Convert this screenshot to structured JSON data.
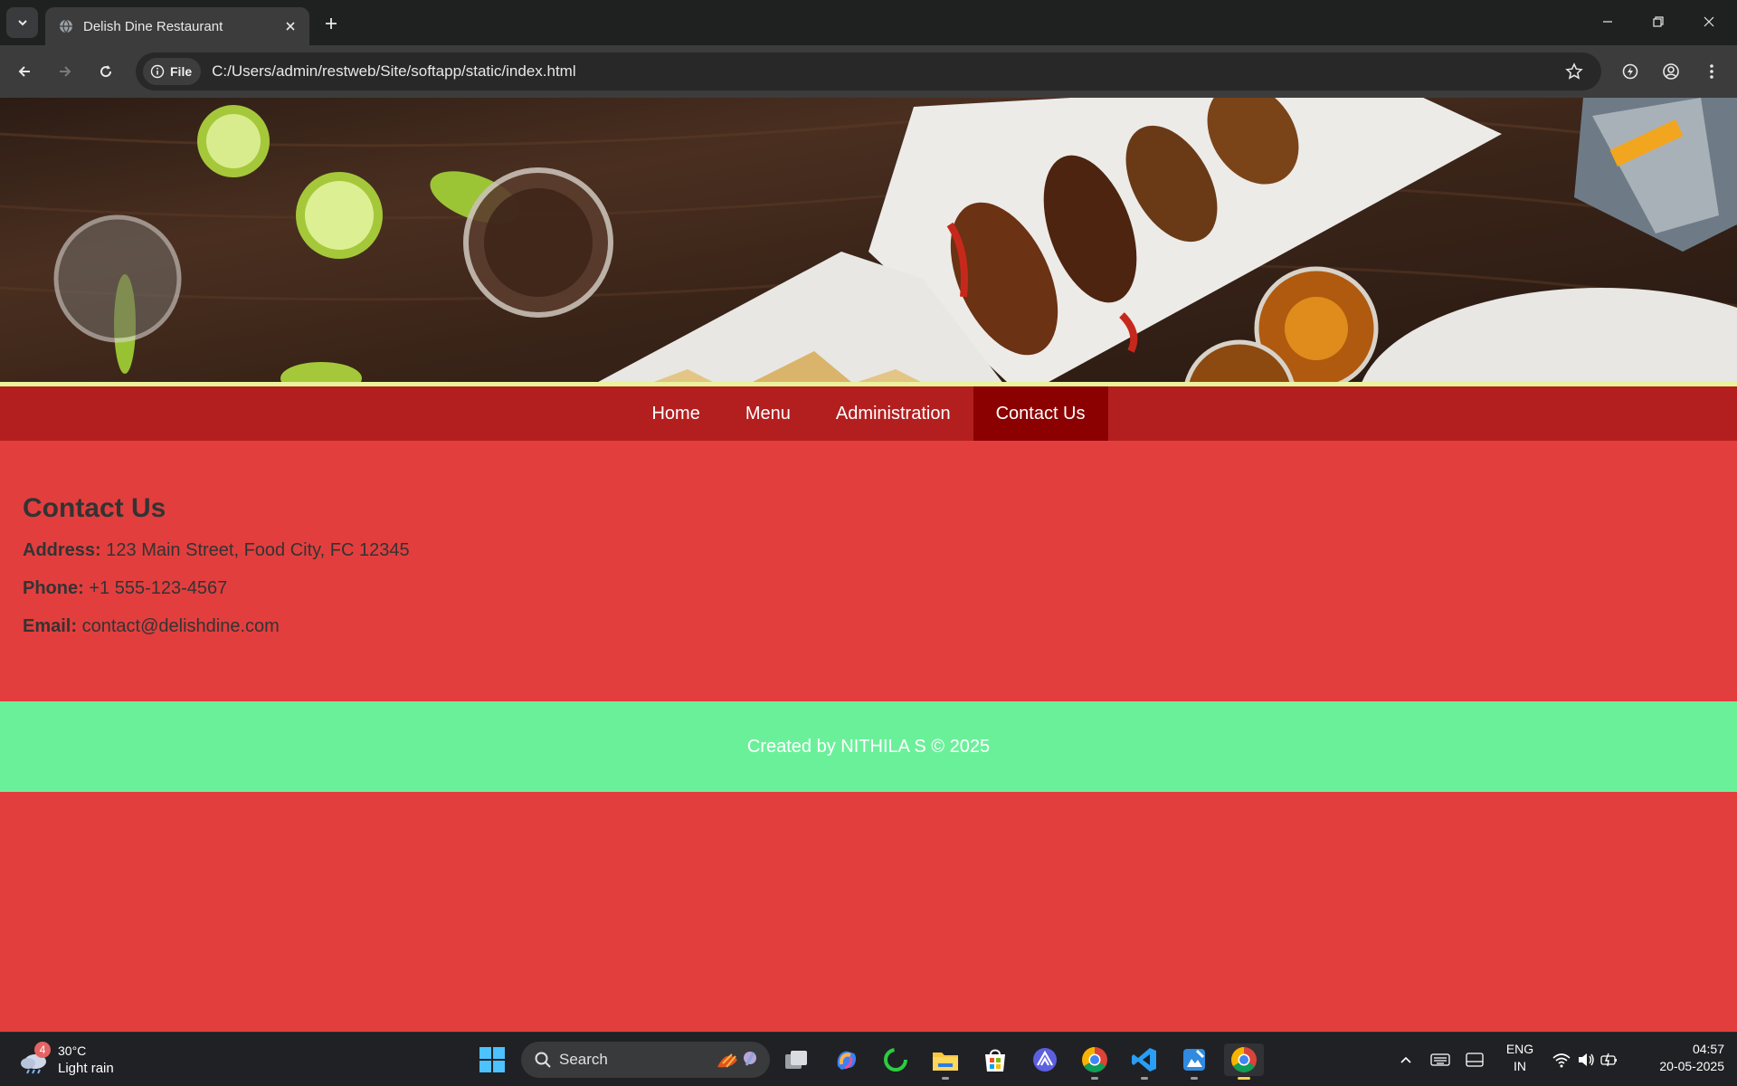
{
  "browser": {
    "tab_title": "Delish Dine Restaurant",
    "site_chip": "File",
    "url": "C:/Users/admin/restweb/Site/softapp/static/index.html"
  },
  "nav": {
    "items": [
      {
        "label": "Home"
      },
      {
        "label": "Menu"
      },
      {
        "label": "Administration"
      },
      {
        "label": "Contact Us"
      }
    ]
  },
  "contact": {
    "heading": "Contact Us",
    "address_label": "Address:",
    "address": "123 Main Street, Food City, FC 12345",
    "phone_label": "Phone:",
    "phone": "+1 555-123-4567",
    "email_label": "Email:",
    "email": "contact@delishdine.com"
  },
  "footer": {
    "text": "Created by NITHILA S © 2025"
  },
  "taskbar": {
    "weather_badge": "4",
    "weather_temp": "30°C",
    "weather_desc": "Light rain",
    "search_label": "Search",
    "lang_top": "ENG",
    "lang_bottom": "IN",
    "time": "04:57",
    "date": "20-05-2025"
  },
  "colors": {
    "page_bg": "#e33e3e",
    "nav_bg": "#b31f1f",
    "nav_active": "#8b0000",
    "footer_bg": "#6bf09a",
    "hero_strip": "#eaf39a"
  }
}
